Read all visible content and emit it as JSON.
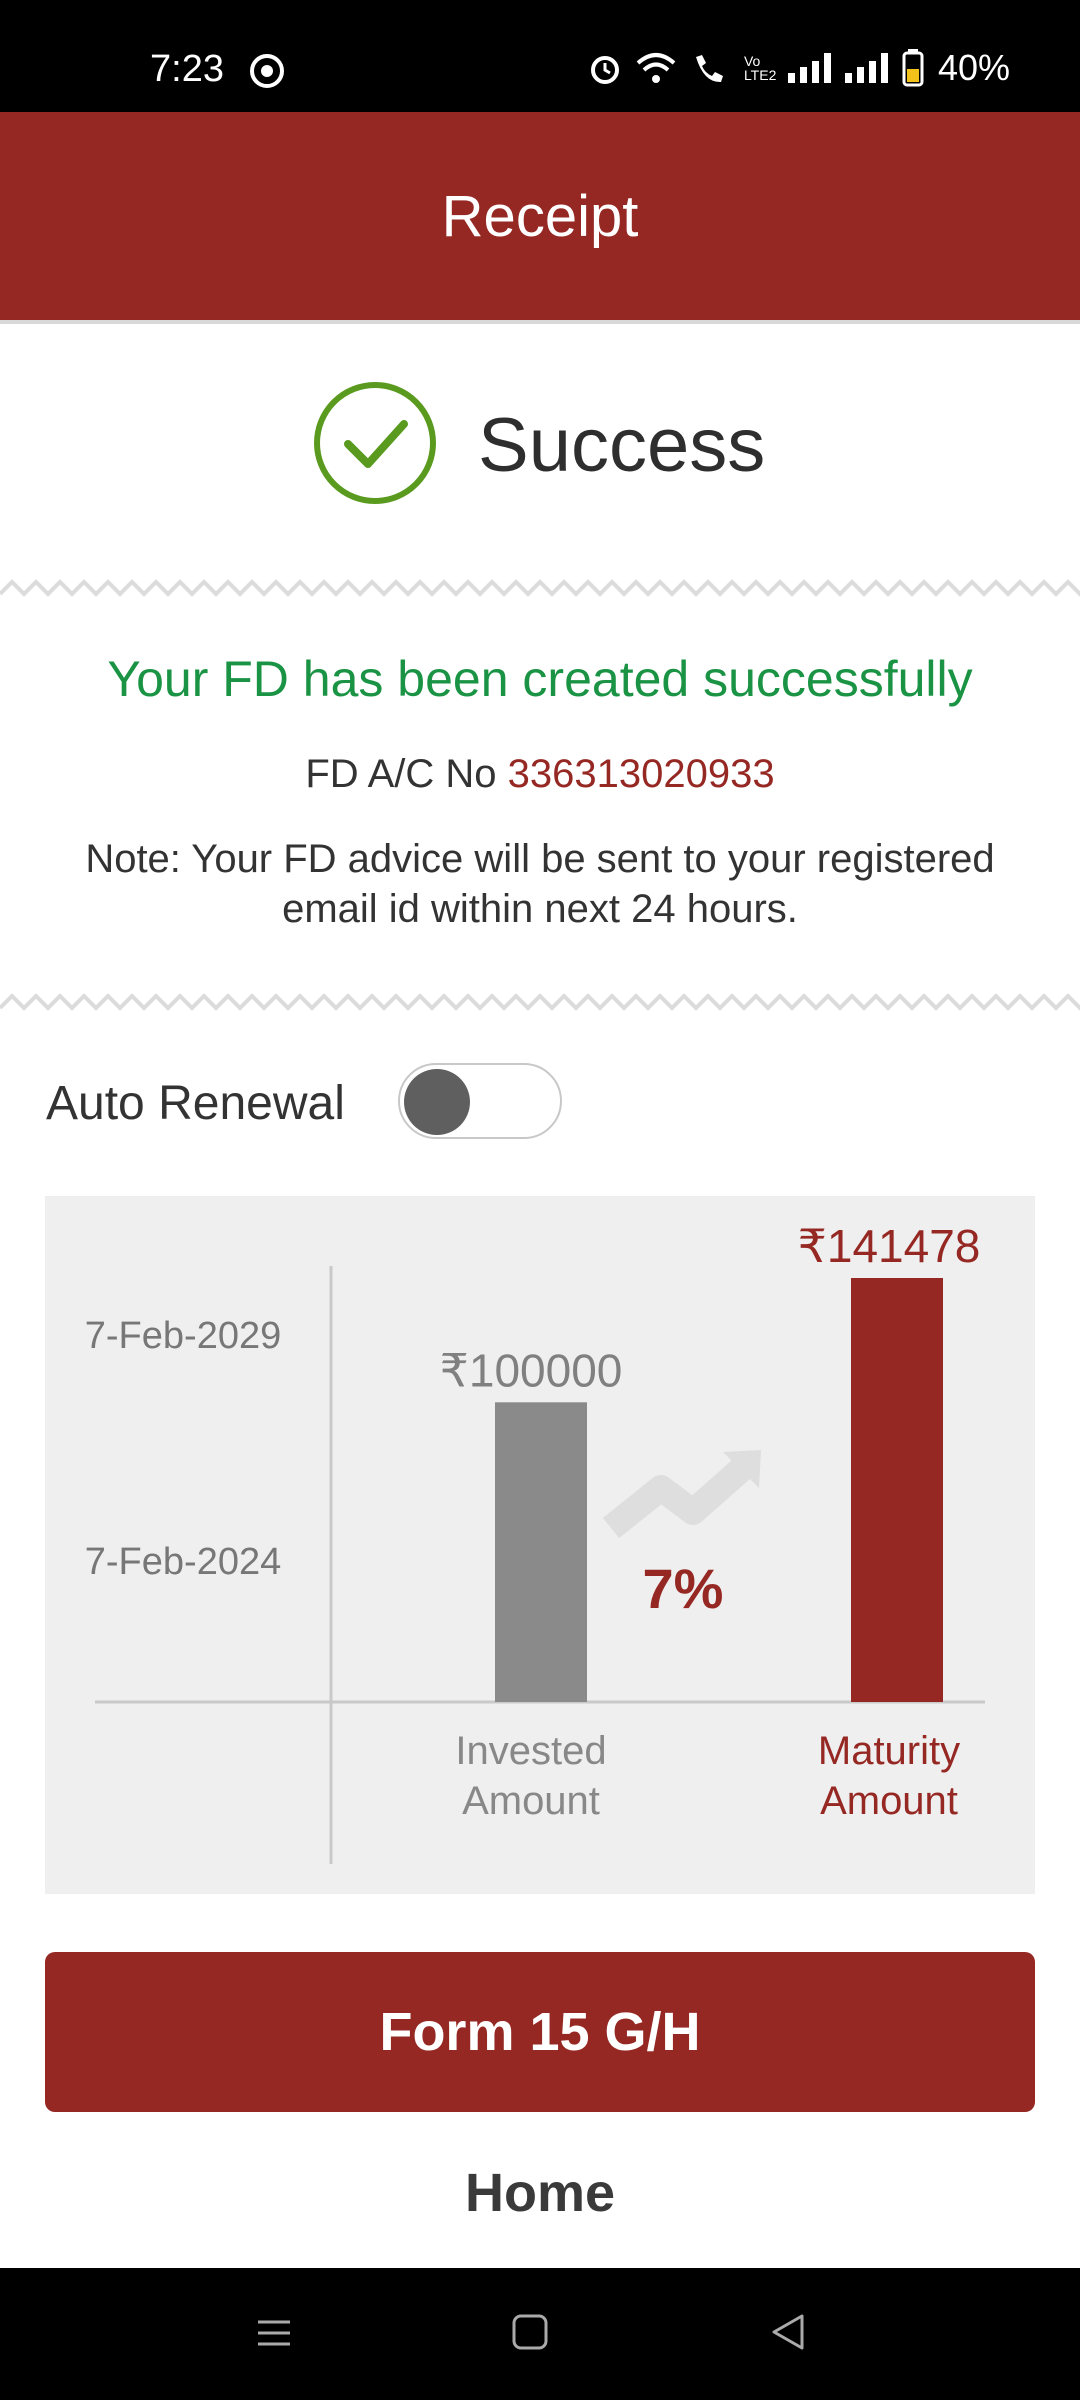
{
  "status_bar": {
    "time": "7:23",
    "battery": "40%",
    "network_label": "Vo LTE2"
  },
  "header": {
    "title": "Receipt"
  },
  "success": {
    "label": "Success"
  },
  "fd": {
    "title": "Your FD has been created successfully",
    "acno_label": "FD A/C No",
    "acno_value": "336313020933",
    "note_line1": "Note: Your FD advice will be sent to your registered",
    "note_line2": "email id within next 24 hours."
  },
  "auto_renewal": {
    "label": "Auto Renewal",
    "enabled": false
  },
  "chart_data": {
    "type": "bar",
    "categories": [
      "Invested Amount",
      "Maturity Amount"
    ],
    "category_lines": [
      [
        "Invested",
        "Amount"
      ],
      [
        "Maturity",
        "Amount"
      ]
    ],
    "values": [
      100000,
      141478
    ],
    "value_labels": [
      "₹100000",
      "₹141478"
    ],
    "y_tick_labels": [
      "7-Feb-2029",
      "7-Feb-2024"
    ],
    "rate_label": "7%",
    "colors": [
      "#8a8a8a",
      "#962824"
    ],
    "ylim": [
      0,
      141478
    ],
    "grid": false
  },
  "buttons": {
    "form": "Form 15 G/H",
    "home": "Home"
  },
  "colors": {
    "brand": "#962824",
    "success_green": "#1a9444",
    "check_green": "#5a9a1e"
  }
}
